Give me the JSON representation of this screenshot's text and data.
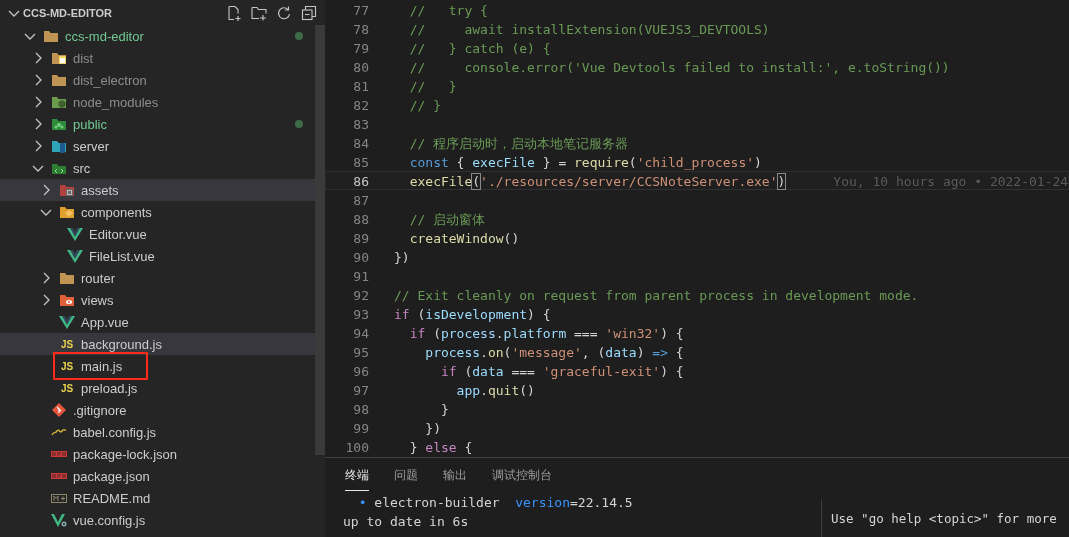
{
  "explorer": {
    "title": "CCS-MD-EDITOR",
    "expanded": true,
    "tree": [
      {
        "label": "ccs-md-editor",
        "kind": "folder",
        "expanded": true,
        "untracked": true,
        "dimmed": false,
        "selected": false,
        "outlined": false,
        "children": [
          {
            "label": "dist",
            "kind": "folder",
            "expanded": false,
            "untracked": false,
            "dimmed": true,
            "selected": false,
            "outlined": false
          },
          {
            "label": "dist_electron",
            "kind": "folder",
            "expanded": false,
            "untracked": false,
            "dimmed": true,
            "selected": false,
            "outlined": false
          },
          {
            "label": "node_modules",
            "kind": "folder",
            "expanded": false,
            "untracked": false,
            "dimmed": true,
            "selected": false,
            "outlined": false
          },
          {
            "label": "public",
            "kind": "folder",
            "expanded": false,
            "untracked": true,
            "dimmed": false,
            "selected": false,
            "outlined": false
          },
          {
            "label": "server",
            "kind": "folder",
            "expanded": false,
            "untracked": false,
            "dimmed": false,
            "selected": false,
            "outlined": false
          },
          {
            "label": "src",
            "kind": "folder",
            "expanded": true,
            "untracked": false,
            "dimmed": false,
            "selected": false,
            "outlined": false,
            "children": [
              {
                "label": "assets",
                "kind": "folder",
                "expanded": false,
                "untracked": false,
                "dimmed": false,
                "selected": true,
                "outlined": false
              },
              {
                "label": "components",
                "kind": "folder",
                "expanded": true,
                "untracked": false,
                "dimmed": false,
                "selected": false,
                "outlined": false,
                "children": [
                  {
                    "label": "Editor.vue",
                    "kind": "vue",
                    "untracked": false,
                    "dimmed": false,
                    "selected": false,
                    "outlined": false
                  },
                  {
                    "label": "FileList.vue",
                    "kind": "vue",
                    "untracked": false,
                    "dimmed": false,
                    "selected": false,
                    "outlined": false
                  }
                ]
              },
              {
                "label": "router",
                "kind": "folder",
                "expanded": false,
                "untracked": false,
                "dimmed": false,
                "selected": false,
                "outlined": false
              },
              {
                "label": "views",
                "kind": "folder",
                "expanded": false,
                "untracked": false,
                "dimmed": false,
                "selected": false,
                "outlined": false
              },
              {
                "label": "App.vue",
                "kind": "vue",
                "untracked": false,
                "dimmed": false,
                "selected": false,
                "outlined": false
              },
              {
                "label": "background.js",
                "kind": "script",
                "badge": "JS",
                "untracked": false,
                "dimmed": false,
                "selected": true,
                "outlined": false
              },
              {
                "label": "main.js",
                "kind": "script",
                "badge": "JS",
                "untracked": false,
                "dimmed": false,
                "selected": false,
                "outlined": true
              },
              {
                "label": "preload.js",
                "kind": "script",
                "badge": "JS",
                "untracked": false,
                "dimmed": false,
                "selected": false,
                "outlined": false
              }
            ]
          },
          {
            "label": ".gitignore",
            "kind": "git",
            "untracked": false,
            "dimmed": false,
            "selected": false,
            "outlined": false
          },
          {
            "label": "babel.config.js",
            "kind": "babel",
            "untracked": false,
            "dimmed": false,
            "selected": false,
            "outlined": false
          },
          {
            "label": "package-lock.json",
            "kind": "npm",
            "untracked": false,
            "dimmed": false,
            "selected": false,
            "outlined": false
          },
          {
            "label": "package.json",
            "kind": "npm",
            "untracked": false,
            "dimmed": false,
            "selected": false,
            "outlined": false
          },
          {
            "label": "README.md",
            "kind": "markdown",
            "untracked": false,
            "dimmed": false,
            "selected": false,
            "outlined": false
          },
          {
            "label": "vue.config.js",
            "kind": "config",
            "untracked": false,
            "dimmed": false,
            "selected": false,
            "outlined": false
          }
        ]
      }
    ]
  },
  "editor": {
    "lines": [
      {
        "number": "77",
        "current": false,
        "tokens": [
          {
            "kind": "comment",
            "text": "  //   try {"
          }
        ]
      },
      {
        "number": "78",
        "current": false,
        "tokens": [
          {
            "kind": "comment",
            "text": "  //     await installExtension(VUEJS3_DEVTOOLS)"
          }
        ]
      },
      {
        "number": "79",
        "current": false,
        "tokens": [
          {
            "kind": "comment",
            "text": "  //   } catch (e) {"
          }
        ]
      },
      {
        "number": "80",
        "current": false,
        "tokens": [
          {
            "kind": "comment",
            "text": "  //     console.error('Vue Devtools failed to install:', e.toString())"
          }
        ]
      },
      {
        "number": "81",
        "current": false,
        "tokens": [
          {
            "kind": "comment",
            "text": "  //   }"
          }
        ]
      },
      {
        "number": "82",
        "current": false,
        "tokens": [
          {
            "kind": "comment",
            "text": "  // }"
          }
        ]
      },
      {
        "number": "83",
        "current": false
      },
      {
        "number": "84",
        "current": false,
        "tokens": [
          {
            "kind": "comment",
            "text": "  // 程序启动时，启动本地笔记服务器"
          }
        ]
      },
      {
        "number": "85",
        "current": false,
        "tokens": [
          {
            "kind": "keyword",
            "text": "  const"
          },
          {
            "kind": "plain",
            "text": " { "
          },
          {
            "kind": "variable",
            "text": "execFile"
          },
          {
            "kind": "plain",
            "text": " } = "
          },
          {
            "kind": "function",
            "text": "require"
          },
          {
            "kind": "plain",
            "text": "("
          },
          {
            "kind": "string",
            "text": "'child_process'"
          },
          {
            "kind": "plain",
            "text": ")"
          }
        ]
      },
      {
        "number": "86",
        "current": true,
        "blame": "You, 10 hours ago • 2022-01-24",
        "tokens": [
          {
            "kind": "function",
            "text": "  execFile"
          },
          {
            "kind": "bracket",
            "text": "("
          },
          {
            "kind": "string",
            "text": "'./resources/server/CCSNoteServer.exe'"
          },
          {
            "kind": "bracket",
            "text": ")"
          }
        ]
      },
      {
        "number": "87",
        "current": false
      },
      {
        "number": "88",
        "current": false,
        "tokens": [
          {
            "kind": "comment",
            "text": "  // 启动窗体"
          }
        ]
      },
      {
        "number": "89",
        "current": false,
        "tokens": [
          {
            "kind": "function",
            "text": "  createWindow"
          },
          {
            "kind": "plain",
            "text": "()"
          }
        ]
      },
      {
        "number": "90",
        "current": false,
        "tokens": [
          {
            "kind": "plain",
            "text": "})"
          }
        ]
      },
      {
        "number": "91",
        "current": false
      },
      {
        "number": "92",
        "current": false,
        "tokens": [
          {
            "kind": "comment",
            "text": "// Exit cleanly on request from parent process in development mode."
          }
        ]
      },
      {
        "number": "93",
        "current": false,
        "tokens": [
          {
            "kind": "control",
            "text": "if"
          },
          {
            "kind": "plain",
            "text": " ("
          },
          {
            "kind": "variable",
            "text": "isDevelopment"
          },
          {
            "kind": "plain",
            "text": ") {"
          }
        ]
      },
      {
        "number": "94",
        "current": false,
        "tokens": [
          {
            "kind": "control",
            "text": "  if"
          },
          {
            "kind": "plain",
            "text": " ("
          },
          {
            "kind": "variable",
            "text": "process"
          },
          {
            "kind": "plain",
            "text": "."
          },
          {
            "kind": "variable",
            "text": "platform"
          },
          {
            "kind": "plain",
            "text": " === "
          },
          {
            "kind": "string",
            "text": "'win32'"
          },
          {
            "kind": "plain",
            "text": ") {"
          }
        ]
      },
      {
        "number": "95",
        "current": false,
        "tokens": [
          {
            "kind": "variable",
            "text": "    process"
          },
          {
            "kind": "plain",
            "text": "."
          },
          {
            "kind": "function",
            "text": "on"
          },
          {
            "kind": "plain",
            "text": "("
          },
          {
            "kind": "string",
            "text": "'message'"
          },
          {
            "kind": "plain",
            "text": ", ("
          },
          {
            "kind": "variable",
            "text": "data"
          },
          {
            "kind": "plain",
            "text": ") "
          },
          {
            "kind": "keyword",
            "text": "=>"
          },
          {
            "kind": "plain",
            "text": " {"
          }
        ]
      },
      {
        "number": "96",
        "current": false,
        "tokens": [
          {
            "kind": "control",
            "text": "      if"
          },
          {
            "kind": "plain",
            "text": " ("
          },
          {
            "kind": "variable",
            "text": "data"
          },
          {
            "kind": "plain",
            "text": " === "
          },
          {
            "kind": "string",
            "text": "'graceful-exit'"
          },
          {
            "kind": "plain",
            "text": ") {"
          }
        ]
      },
      {
        "number": "97",
        "current": false,
        "tokens": [
          {
            "kind": "variable",
            "text": "        app"
          },
          {
            "kind": "plain",
            "text": "."
          },
          {
            "kind": "function",
            "text": "quit"
          },
          {
            "kind": "plain",
            "text": "()"
          }
        ]
      },
      {
        "number": "98",
        "current": false,
        "tokens": [
          {
            "kind": "plain",
            "text": "      }"
          }
        ]
      },
      {
        "number": "99",
        "current": false,
        "tokens": [
          {
            "kind": "plain",
            "text": "    })"
          }
        ]
      },
      {
        "number": "100",
        "current": false,
        "tokens": [
          {
            "kind": "plain",
            "text": "  } "
          },
          {
            "kind": "control",
            "text": "else"
          },
          {
            "kind": "plain",
            "text": " {"
          }
        ]
      }
    ]
  },
  "panel": {
    "tabs": [
      {
        "label": "终端",
        "selected": true
      },
      {
        "label": "问题",
        "selected": false
      },
      {
        "label": "输出",
        "selected": false
      },
      {
        "label": "调试控制台",
        "selected": false
      }
    ],
    "terminal_left": [
      {
        "tokens": [
          {
            "kind": "bullet",
            "text": "  • "
          },
          {
            "kind": "plain",
            "text": "electron-builder  "
          },
          {
            "kind": "key",
            "text": "version"
          },
          {
            "kind": "plain",
            "text": "=22.14.5"
          }
        ]
      },
      {
        "tokens": [
          {
            "kind": "plain",
            "text": "up to date in 6s"
          }
        ]
      }
    ],
    "terminal_right": [
      {
        "tokens": [
          {
            "kind": "plain",
            "text": "Use \"go help <topic>\" for more"
          }
        ]
      }
    ]
  }
}
